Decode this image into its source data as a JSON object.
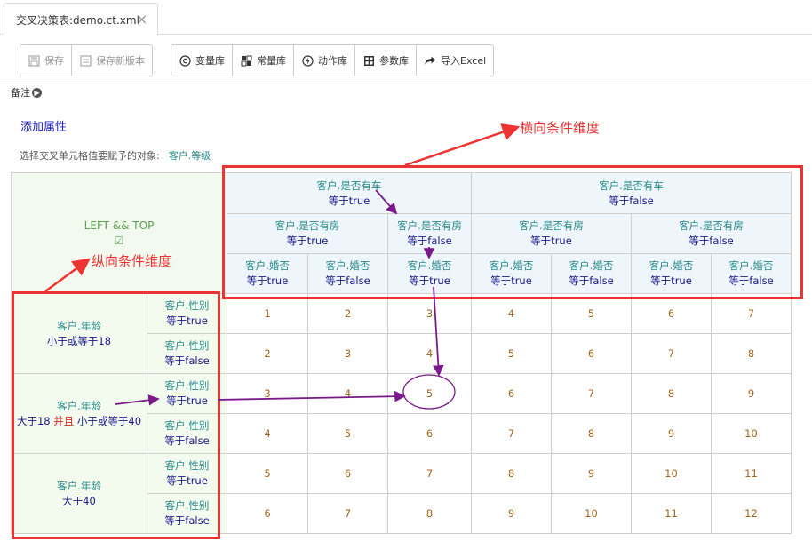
{
  "tab": {
    "title": "交叉决策表:demo.ct.xml",
    "close": "×"
  },
  "toolbar": {
    "group1": [
      {
        "label": "保存",
        "icon": "save-icon"
      },
      {
        "label": "保存新版本",
        "icon": "save-version-icon"
      }
    ],
    "group2": [
      {
        "label": "变量库",
        "icon": "copyright-icon"
      },
      {
        "label": "常量库",
        "icon": "grid-icon"
      },
      {
        "label": "动作库",
        "icon": "bolt-icon"
      },
      {
        "label": "参数库",
        "icon": "table-icon"
      },
      {
        "label": "导入Excel",
        "icon": "share-arrow-icon"
      }
    ]
  },
  "note": {
    "label": "备注"
  },
  "add_property": "添加属性",
  "target": {
    "label": "选择交叉单元格值要赋予的对象:",
    "value": "客户.等级"
  },
  "corner": {
    "label": "LEFT && TOP",
    "edit": "☑"
  },
  "top_headers": {
    "level1": [
      {
        "var": "客户.是否有车",
        "cond": "等于true"
      },
      {
        "var": "客户.是否有车",
        "cond": "等于false"
      }
    ],
    "level2": [
      {
        "var": "客户.是否有房",
        "cond": "等于true"
      },
      {
        "var": "客户.是否有房",
        "cond": "等于false"
      },
      {
        "var": "客户.是否有房",
        "cond": "等于true"
      },
      {
        "var": "客户.是否有房",
        "cond": "等于false"
      }
    ],
    "level3": [
      {
        "var": "客户.婚否",
        "cond": "等于true"
      },
      {
        "var": "客户.婚否",
        "cond": "等于false"
      },
      {
        "var": "客户.婚否",
        "cond": "等于true"
      },
      {
        "var": "客户.婚否",
        "cond": "等于true"
      },
      {
        "var": "客户.婚否",
        "cond": "等于false"
      },
      {
        "var": "客户.婚否",
        "cond": "等于true"
      },
      {
        "var": "客户.婚否",
        "cond": "等于false"
      }
    ]
  },
  "left_headers": [
    {
      "var": "客户.年龄",
      "cond": "小于或等于18",
      "sub": [
        {
          "var": "客户.性别",
          "cond": "等于true"
        },
        {
          "var": "客户.性别",
          "cond": "等于false"
        }
      ]
    },
    {
      "var": "客户.年龄",
      "cond_a": "大于18",
      "and": "并且",
      "cond_b": "小于或等于40",
      "sub": [
        {
          "var": "客户.性别",
          "cond": "等于true"
        },
        {
          "var": "客户.性别",
          "cond": "等于false"
        }
      ]
    },
    {
      "var": "客户.年龄",
      "cond": "大于40",
      "sub": [
        {
          "var": "客户.性别",
          "cond": "等于true"
        },
        {
          "var": "客户.性别",
          "cond": "等于false"
        }
      ]
    }
  ],
  "cells": [
    [
      "1",
      "2",
      "3",
      "4",
      "5",
      "6",
      "7"
    ],
    [
      "2",
      "3",
      "4",
      "5",
      "6",
      "7",
      "8"
    ],
    [
      "3",
      "4",
      "5",
      "6",
      "7",
      "8",
      "9"
    ],
    [
      "4",
      "5",
      "6",
      "7",
      "8",
      "9",
      "10"
    ],
    [
      "5",
      "6",
      "7",
      "8",
      "9",
      "10",
      "11"
    ],
    [
      "6",
      "7",
      "8",
      "9",
      "10",
      "11",
      "12"
    ]
  ],
  "annotations": {
    "horizontal": "横向条件维度",
    "vertical": "纵向条件维度"
  },
  "colors": {
    "annotation": "#e33333",
    "arrow": "#7a1a8a",
    "variable": "#2a8a8a",
    "condition": "#1a1a8a",
    "value": "#a0661f"
  }
}
